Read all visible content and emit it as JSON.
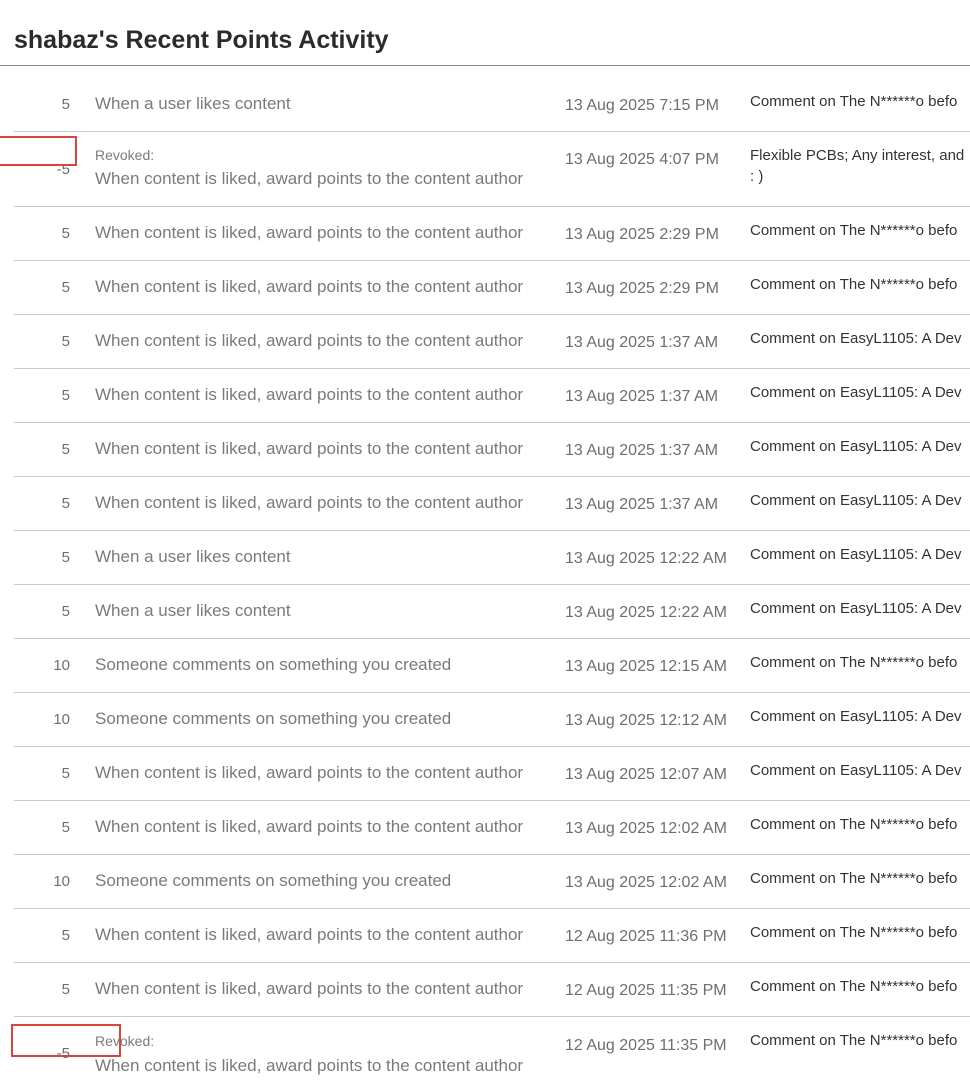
{
  "page": {
    "title": "shabaz's Recent Points Activity"
  },
  "activity": [
    {
      "points": "5",
      "revoked": "",
      "action": "When a user likes content",
      "date": "13 Aug 2025 7:15 PM",
      "content": "Comment on The N******o befo"
    },
    {
      "points": "-5",
      "revoked": "Revoked:",
      "action": "When content is liked, award points to the content author",
      "date": "13 Aug 2025 4:07 PM",
      "content": "Flexible PCBs; Any interest, and",
      "content_line2": ": )"
    },
    {
      "points": "5",
      "revoked": "",
      "action": "When content is liked, award points to the content author",
      "date": "13 Aug 2025 2:29 PM",
      "content": "Comment on The N******o befo"
    },
    {
      "points": "5",
      "revoked": "",
      "action": "When content is liked, award points to the content author",
      "date": "13 Aug 2025 2:29 PM",
      "content": "Comment on The N******o befo"
    },
    {
      "points": "5",
      "revoked": "",
      "action": "When content is liked, award points to the content author",
      "date": "13 Aug 2025 1:37 AM",
      "content": "Comment on EasyL1105: A Dev"
    },
    {
      "points": "5",
      "revoked": "",
      "action": "When content is liked, award points to the content author",
      "date": "13 Aug 2025 1:37 AM",
      "content": "Comment on EasyL1105: A Dev"
    },
    {
      "points": "5",
      "revoked": "",
      "action": "When content is liked, award points to the content author",
      "date": "13 Aug 2025 1:37 AM",
      "content": "Comment on EasyL1105: A Dev"
    },
    {
      "points": "5",
      "revoked": "",
      "action": "When content is liked, award points to the content author",
      "date": "13 Aug 2025 1:37 AM",
      "content": "Comment on EasyL1105: A Dev"
    },
    {
      "points": "5",
      "revoked": "",
      "action": "When a user likes content",
      "date": "13 Aug 2025 12:22 AM",
      "content": "Comment on EasyL1105: A Dev"
    },
    {
      "points": "5",
      "revoked": "",
      "action": "When a user likes content",
      "date": "13 Aug 2025 12:22 AM",
      "content": "Comment on EasyL1105: A Dev"
    },
    {
      "points": "10",
      "revoked": "",
      "action": "Someone comments on something you created",
      "date": "13 Aug 2025 12:15 AM",
      "content": "Comment on The N******o befo"
    },
    {
      "points": "10",
      "revoked": "",
      "action": "Someone comments on something you created",
      "date": "13 Aug 2025 12:12 AM",
      "content": "Comment on EasyL1105: A Dev"
    },
    {
      "points": "5",
      "revoked": "",
      "action": "When content is liked, award points to the content author",
      "date": "13 Aug 2025 12:07 AM",
      "content": "Comment on EasyL1105: A Dev"
    },
    {
      "points": "5",
      "revoked": "",
      "action": "When content is liked, award points to the content author",
      "date": "13 Aug 2025 12:02 AM",
      "content": "Comment on The N******o befo"
    },
    {
      "points": "10",
      "revoked": "",
      "action": "Someone comments on something you created",
      "date": "13 Aug 2025 12:02 AM",
      "content": "Comment on The N******o befo"
    },
    {
      "points": "5",
      "revoked": "",
      "action": "When content is liked, award points to the content author",
      "date": "12 Aug 2025 11:36 PM",
      "content": "Comment on The N******o befo"
    },
    {
      "points": "5",
      "revoked": "",
      "action": "When content is liked, award points to the content author",
      "date": "12 Aug 2025 11:35 PM",
      "content": "Comment on The N******o befo"
    },
    {
      "points": "-5",
      "revoked": "Revoked:",
      "action": "When content is liked, award points to the content author",
      "date": "12 Aug 2025 11:35 PM",
      "content": "Comment on The N******o befo"
    }
  ],
  "colors": {
    "highlight_box": "#d9443c",
    "row_divider": "#c8c8c8"
  }
}
